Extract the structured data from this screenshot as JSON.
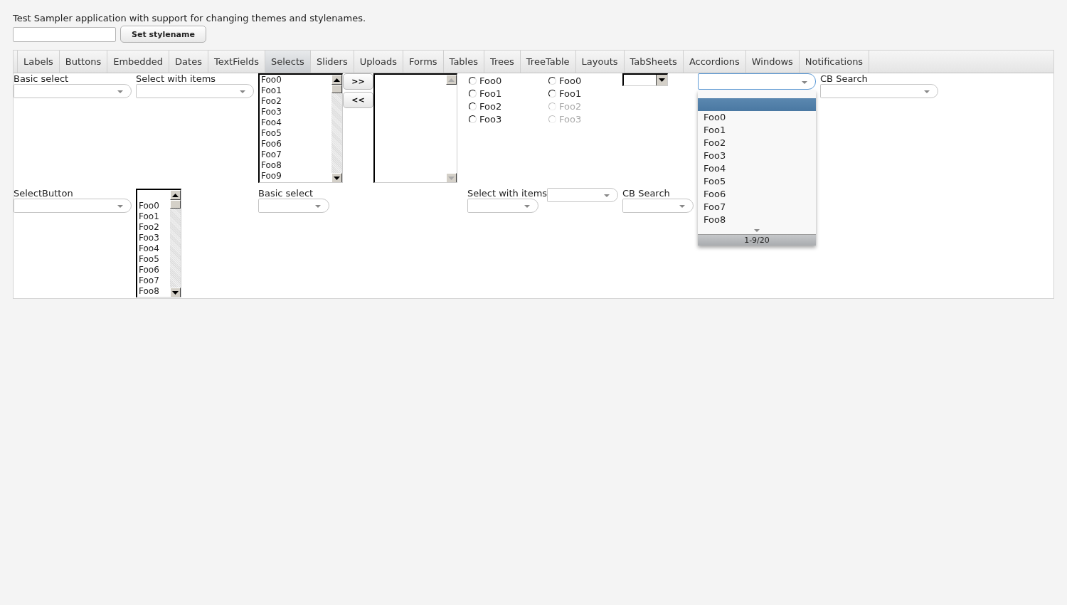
{
  "description": "Test Sampler application with support for changing themes and stylenames.",
  "stylename_button": "Set stylename",
  "tabs": [
    {
      "label": "Labels",
      "selected": false
    },
    {
      "label": "Buttons",
      "selected": false
    },
    {
      "label": "Embedded",
      "selected": false
    },
    {
      "label": "Dates",
      "selected": false
    },
    {
      "label": "TextFields",
      "selected": false
    },
    {
      "label": "Selects",
      "selected": true
    },
    {
      "label": "Sliders",
      "selected": false
    },
    {
      "label": "Uploads",
      "selected": false
    },
    {
      "label": "Forms",
      "selected": false
    },
    {
      "label": "Tables",
      "selected": false
    },
    {
      "label": "Trees",
      "selected": false
    },
    {
      "label": "TreeTable",
      "selected": false
    },
    {
      "label": "Layouts",
      "selected": false
    },
    {
      "label": "TabSheets",
      "selected": false
    },
    {
      "label": "Accordions",
      "selected": false
    },
    {
      "label": "Windows",
      "selected": false
    },
    {
      "label": "Notifications",
      "selected": false
    }
  ],
  "row_1": [
    {
      "kind": "select",
      "caption": "Basic select"
    },
    {
      "kind": "select",
      "caption": "Select with items"
    },
    {
      "kind": "twin_select",
      "add": ">>",
      "remove": "<<",
      "options": [
        "Foo0",
        "Foo1",
        "Foo2",
        "Foo3",
        "Foo4",
        "Foo5",
        "Foo6",
        "Foo7",
        "Foo8",
        "Foo9"
      ]
    },
    {
      "kind": "option_group",
      "items": [
        {
          "label": "Foo0",
          "selected": false,
          "disabled": false
        },
        {
          "label": "Foo1",
          "selected": false,
          "disabled": false
        },
        {
          "label": "Foo2",
          "selected": false,
          "disabled": false
        },
        {
          "label": "Foo3",
          "selected": false,
          "disabled": false
        }
      ]
    },
    {
      "kind": "option_group",
      "items": [
        {
          "label": "Foo0",
          "selected": false,
          "disabled": false
        },
        {
          "label": "Foo1",
          "selected": false,
          "disabled": false
        },
        {
          "label": "Foo2",
          "selected": false,
          "disabled": true
        },
        {
          "label": "Foo3",
          "selected": false,
          "disabled": true
        }
      ]
    },
    {
      "kind": "native_select"
    },
    {
      "kind": "combo_box",
      "expanded": true,
      "null_item_selected": true,
      "options": [
        {
          "label": "Foo0",
          "selected": false
        },
        {
          "label": "Foo1",
          "selected": false
        },
        {
          "label": "Foo2",
          "selected": false
        },
        {
          "label": "Foo3",
          "selected": false
        },
        {
          "label": "Foo4",
          "selected": false
        },
        {
          "label": "Foo5",
          "selected": false
        },
        {
          "label": "Foo6",
          "selected": false
        },
        {
          "label": "Foo7",
          "selected": false
        },
        {
          "label": "Foo8",
          "selected": false
        }
      ],
      "pager": "1-9/20"
    },
    {
      "kind": "select",
      "caption": "CB Search"
    }
  ],
  "row_2": [
    {
      "kind": "select",
      "caption": "SelectButton"
    },
    {
      "kind": "list_select",
      "null_item": true,
      "options": [
        "Foo0",
        "Foo1",
        "Foo2",
        "Foo3",
        "Foo4",
        "Foo5",
        "Foo6",
        "Foo7",
        "Foo8"
      ]
    },
    {
      "kind": "select",
      "caption": "Basic select"
    },
    {
      "kind": "select",
      "caption": "Select with items"
    },
    {
      "kind": "select"
    },
    {
      "kind": "select",
      "caption": "CB Search"
    }
  ]
}
